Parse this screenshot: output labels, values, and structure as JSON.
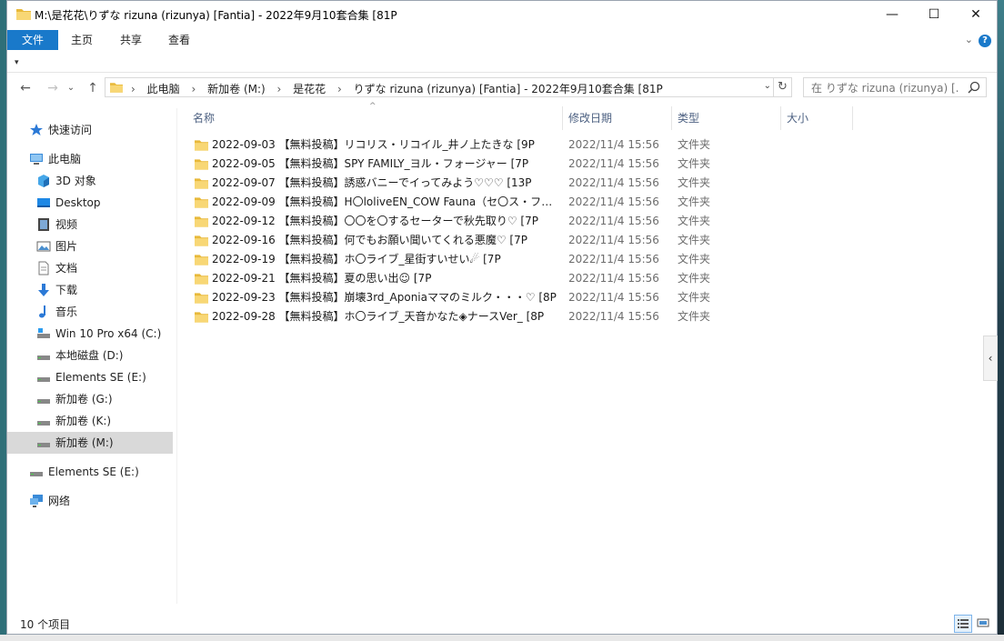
{
  "window": {
    "title": "M:\\是花花\\りずな rizuna (rizunya) [Fantia] - 2022年9月10套合集 [81P",
    "minimize": "—",
    "maximize": "☐",
    "close": "✕"
  },
  "ribbon": {
    "tabs": [
      "文件",
      "主页",
      "共享",
      "查看"
    ],
    "expand": "⌄",
    "help": "?"
  },
  "qat": "▾",
  "nav": {
    "back": "←",
    "forward": "→",
    "recent": "⌄",
    "up": "↑"
  },
  "address": {
    "chevron": "›",
    "crumbs": [
      "此电脑",
      "新加卷 (M:)",
      "是花花",
      "りずな rizuna (rizunya) [Fantia] - 2022年9月10套合集 [81P"
    ],
    "dropdown": "⌄",
    "refresh": "↻"
  },
  "search": {
    "placeholder": "在 りずな rizuna (rizunya) [..."
  },
  "sidebar": {
    "items": [
      {
        "label": "快速访问",
        "icon": "star-icon"
      },
      {
        "label": "此电脑",
        "icon": "computer-icon"
      },
      {
        "label": "3D 对象",
        "icon": "cube-icon"
      },
      {
        "label": "Desktop",
        "icon": "desktop-icon"
      },
      {
        "label": "视频",
        "icon": "video-icon"
      },
      {
        "label": "图片",
        "icon": "picture-icon"
      },
      {
        "label": "文档",
        "icon": "document-icon"
      },
      {
        "label": "下载",
        "icon": "download-icon"
      },
      {
        "label": "音乐",
        "icon": "music-icon"
      },
      {
        "label": "Win 10 Pro x64 (C:)",
        "icon": "windows-drive-icon"
      },
      {
        "label": "本地磁盘 (D:)",
        "icon": "drive-icon"
      },
      {
        "label": "Elements SE (E:)",
        "icon": "drive-icon"
      },
      {
        "label": "新加卷 (G:)",
        "icon": "drive-icon"
      },
      {
        "label": "新加卷 (K:)",
        "icon": "drive-icon"
      },
      {
        "label": "新加卷 (M:)",
        "icon": "drive-icon"
      },
      {
        "label": "Elements SE (E:)",
        "icon": "drive-icon"
      },
      {
        "label": "网络",
        "icon": "network-icon"
      }
    ]
  },
  "columns": {
    "name": "名称",
    "date": "修改日期",
    "type": "类型",
    "size": "大小",
    "sort_indicator": "^"
  },
  "files": [
    {
      "name": "2022-09-03 【無料投稿】リコリス・リコイル_井ノ上たきな [9P",
      "date": "2022/11/4 15:56",
      "type": "文件夹"
    },
    {
      "name": "2022-09-05 【無料投稿】SPY FAMILY_ヨル・フォージャー [7P",
      "date": "2022/11/4 15:56",
      "type": "文件夹"
    },
    {
      "name": "2022-09-07 【無料投稿】誘惑バニーでイってみよう♡♡♡ [13P",
      "date": "2022/11/4 15:56",
      "type": "文件夹"
    },
    {
      "name": "2022-09-09 【無料投稿】H〇loliveEN_COW Fauna（セ〇ス・ファ...",
      "date": "2022/11/4 15:56",
      "type": "文件夹"
    },
    {
      "name": "2022-09-12 【無料投稿】〇〇を〇するセーターで秋先取り♡ [7P",
      "date": "2022/11/4 15:56",
      "type": "文件夹"
    },
    {
      "name": "2022-09-16 【無料投稿】何でもお願い聞いてくれる悪魔♡ [7P",
      "date": "2022/11/4 15:56",
      "type": "文件夹"
    },
    {
      "name": "2022-09-19 【無料投稿】ホ〇ライブ_星街すいせい☄ [7P",
      "date": "2022/11/4 15:56",
      "type": "文件夹"
    },
    {
      "name": "2022-09-21 【無料投稿】夏の思い出☺ [7P",
      "date": "2022/11/4 15:56",
      "type": "文件夹"
    },
    {
      "name": "2022-09-23 【無料投稿】崩壊3rd_Aponiaママのミルク・・・♡ [8P",
      "date": "2022/11/4 15:56",
      "type": "文件夹"
    },
    {
      "name": "2022-09-28 【無料投稿】ホ〇ライブ_天音かなた◈ナースVer_ [8P",
      "date": "2022/11/4 15:56",
      "type": "文件夹"
    }
  ],
  "status": {
    "count": "10 个项目"
  },
  "panel_toggle": "‹",
  "colors": {
    "accent": "#1979ca",
    "folder": "#f8d775",
    "selected_bg": "#d9d9d9"
  }
}
